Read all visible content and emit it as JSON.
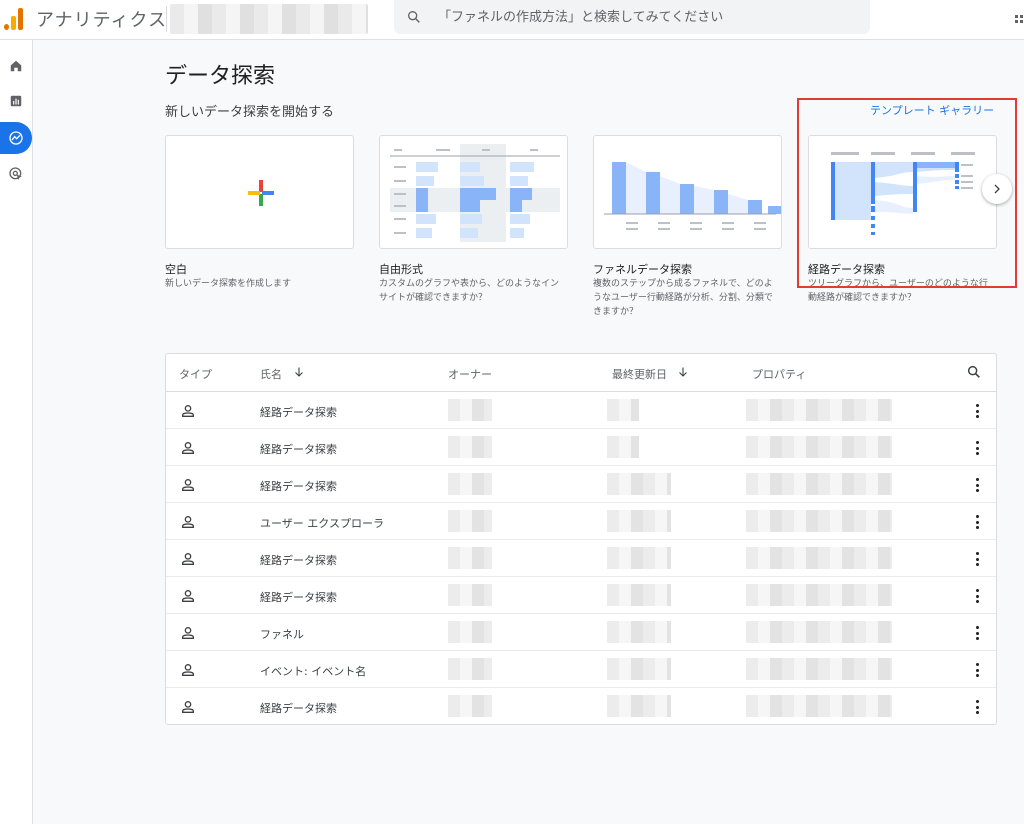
{
  "header": {
    "app_title": "アナリティクス",
    "search_placeholder": "「ファネルの作成方法」と検索してみてください"
  },
  "colors": {
    "accent": "#1a73e8",
    "highlight": "#e53935",
    "chart_blue": "#8ab4f8"
  },
  "sidebar": {
    "items": [
      {
        "icon": "home-icon"
      },
      {
        "icon": "reports-icon"
      },
      {
        "icon": "explore-icon",
        "active": true
      },
      {
        "icon": "advertising-icon"
      }
    ]
  },
  "main": {
    "title": "データ探索",
    "subtitle": "新しいデータ探索を開始する",
    "gallery_link": "テンプレート ギャラリー"
  },
  "templates": [
    {
      "title": "空白",
      "desc": "新しいデータ探索を作成します"
    },
    {
      "title": "自由形式",
      "desc": "カスタムのグラフや表から、どのようなインサイトが確認できますか？"
    },
    {
      "title": "ファネルデータ探索",
      "desc": "複数のステップから成るファネルで、どのようなユーザー行動経路が分析、分割、分類できますか？"
    },
    {
      "title": "経路データ探索",
      "desc": "ツリーグラフから、ユーザーのどのような行動経路が確認できますか？"
    }
  ],
  "table": {
    "columns": {
      "type": "タイプ",
      "name": "氏名",
      "owner": "オーナー",
      "modified": "最終更新日",
      "property": "プロパティ"
    },
    "rows": [
      {
        "name": "経路データ探索"
      },
      {
        "name": "経路データ探索"
      },
      {
        "name": "経路データ探索"
      },
      {
        "name": "ユーザー エクスプローラ"
      },
      {
        "name": "経路データ探索"
      },
      {
        "name": "経路データ探索"
      },
      {
        "name": "ファネル"
      },
      {
        "name": "イベント: イベント名"
      },
      {
        "name": "経路データ探索"
      }
    ]
  }
}
